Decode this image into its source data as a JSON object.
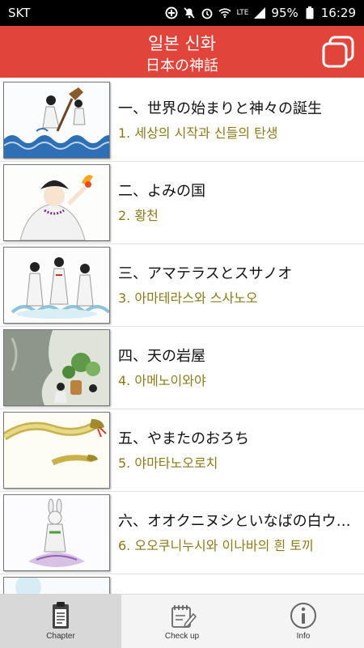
{
  "status": {
    "carrier": "SKT",
    "battery": "95%",
    "time": "16:29",
    "lte": "LTE"
  },
  "header": {
    "title_ko": "일본 신화",
    "title_ja": "日本の神話"
  },
  "chapters": [
    {
      "title_ja": "一、世界の始まりと神々の誕生",
      "title_ko": "1. 세상의 시작과 신들의 탄생"
    },
    {
      "title_ja": "二、よみの国",
      "title_ko": "2. 황천"
    },
    {
      "title_ja": "三、アマテラスとスサノオ",
      "title_ko": "3. 아마테라스와 스사노오"
    },
    {
      "title_ja": "四、天の岩屋",
      "title_ko": "4. 아메노이와야"
    },
    {
      "title_ja": "五、やまたのおろち",
      "title_ko": "5. 야마타노오로치"
    },
    {
      "title_ja": "六、オオクニヌシといなばの白ウサギ",
      "title_ko": "6. 오오쿠니누시와 이나바의 흰 토끼"
    }
  ],
  "tabs": [
    {
      "label": "Chapter",
      "icon": "clipboard-icon"
    },
    {
      "label": "Check up",
      "icon": "notepad-pencil-icon"
    },
    {
      "label": "Info",
      "icon": "info-icon"
    }
  ],
  "colors": {
    "header_bg": "#e0443a",
    "korean_text": "#8b7a1a"
  }
}
